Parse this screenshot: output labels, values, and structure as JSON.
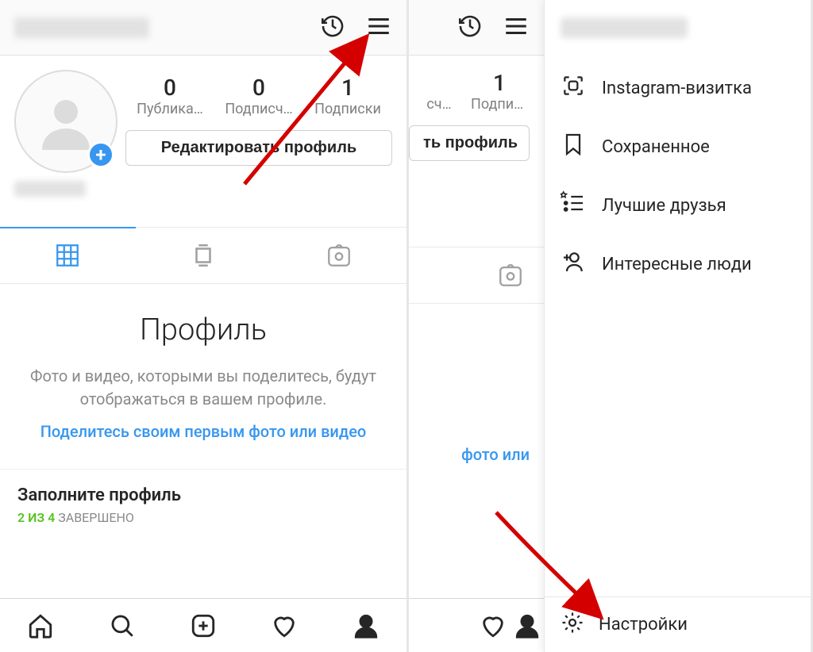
{
  "screen1": {
    "stats": {
      "posts_num": "0",
      "posts_label": "Публика…",
      "followers_num": "0",
      "followers_label": "Подписч…",
      "following_num": "1",
      "following_label": "Подписки"
    },
    "edit_button": "Редактировать профиль",
    "empty": {
      "title": "Профиль",
      "desc": "Фото и видео, которыми вы поделитесь, будут отображаться в вашем профиле.",
      "link": "Поделитесь своим первым фото или видео"
    },
    "fill": {
      "title": "Заполните профиль",
      "done_part": "2 ИЗ 4",
      "rest": " ЗАВЕРШЕНО"
    }
  },
  "screen2": {
    "stats": {
      "followers_label": "сч…",
      "following_num": "1",
      "following_label": "Подписки"
    },
    "edit_button": "ть профиль",
    "empty_link_frag": "фото или",
    "menu": {
      "nametag": "Instagram-визитка",
      "saved": "Сохраненное",
      "close_friends": "Лучшие друзья",
      "discover": "Интересные люди"
    },
    "settings": "Настройки"
  }
}
